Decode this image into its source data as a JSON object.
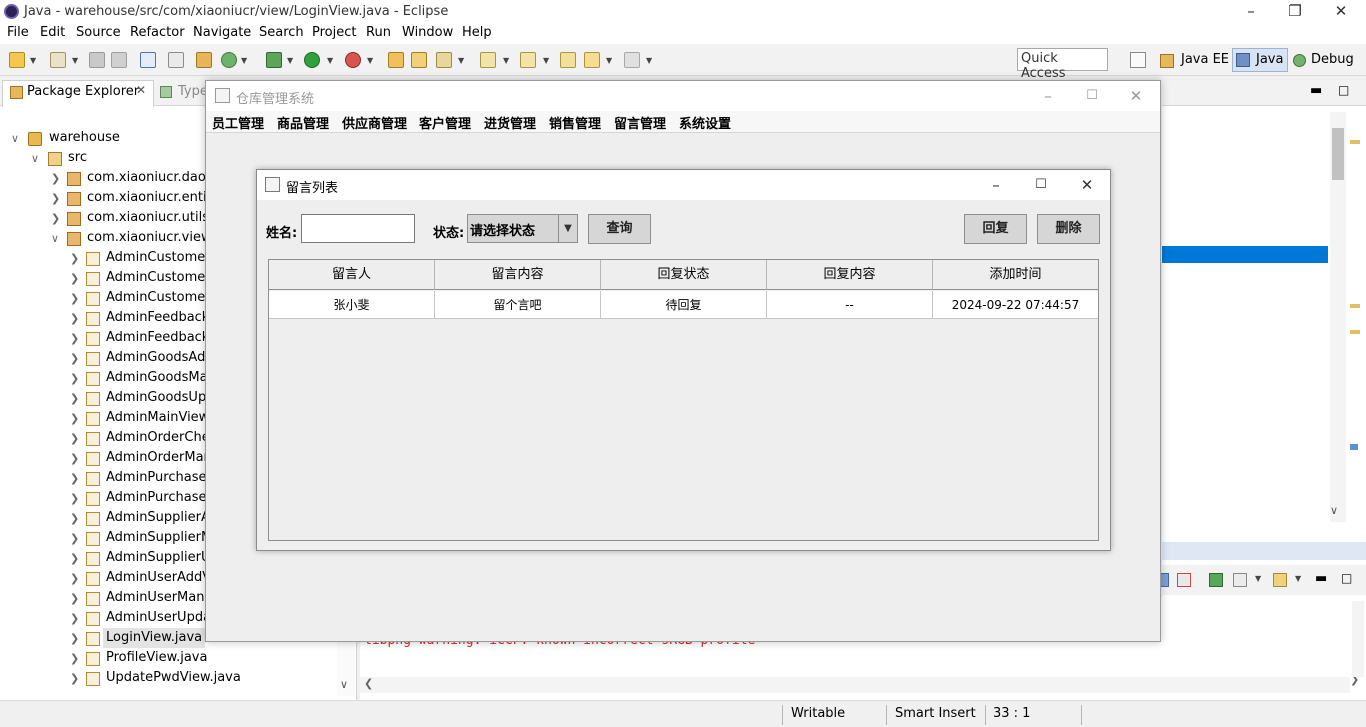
{
  "eclipse": {
    "title": "Java - warehouse/src/com/xiaoniucr/view/LoginView.java - Eclipse",
    "menu": [
      "File",
      "Edit",
      "Source",
      "Refactor",
      "Navigate",
      "Search",
      "Project",
      "Run",
      "Window",
      "Help"
    ],
    "quick_access": "Quick Access",
    "perspectives": [
      "Java EE",
      "Java",
      "Debug"
    ],
    "package_explorer_tab": "Package Explorer",
    "type_tab": "Type",
    "tree": {
      "project": "warehouse",
      "src": "src",
      "packages": [
        "com.xiaoniucr.dao",
        "com.xiaoniucr.entity",
        "com.xiaoniucr.utils",
        "com.xiaoniucr.view"
      ],
      "files": [
        "AdminCustomerA",
        "AdminCustomerM",
        "AdminCustomerU",
        "AdminFeedbackM",
        "AdminFeedbackR",
        "AdminGoodsAdd",
        "AdminGoodsMar",
        "AdminGoodsUpd",
        "AdminMainView.j",
        "AdminOrderChec",
        "AdminOrderMana",
        "AdminPurchaseCl",
        "AdminPurchaseM",
        "AdminSupplierAd",
        "AdminSupplierMa",
        "AdminSupplierUp",
        "AdminUserAddVi",
        "AdminUserManag",
        "AdminUserUpdat",
        "LoginView.java",
        "ProfileView.java",
        "UpdatePwdView.java"
      ]
    },
    "console_text": "libpng warning: iCCP: known incorrect sRGB profile",
    "status": {
      "writable": "Writable",
      "insert_mode": "Smart Insert",
      "position": "33 : 1"
    }
  },
  "mainframe": {
    "title": "仓库管理系统",
    "menu": [
      "员工管理",
      "商品管理",
      "供应商管理",
      "客户管理",
      "进货管理",
      "销售管理",
      "留言管理",
      "系统设置"
    ]
  },
  "dialog": {
    "title": "留言列表",
    "name_label": "姓名:",
    "name_value": "",
    "status_label": "状态:",
    "status_selected": "请选择状态",
    "query_button": "查询",
    "reply_button": "回复",
    "delete_button": "删除",
    "table": {
      "headers": [
        "留言人",
        "留言内容",
        "回复状态",
        "回复内容",
        "添加时间"
      ],
      "rows": [
        [
          "张小斐",
          "留个言吧",
          "待回复",
          "--",
          "2024-09-22 07:44:57"
        ]
      ]
    }
  }
}
